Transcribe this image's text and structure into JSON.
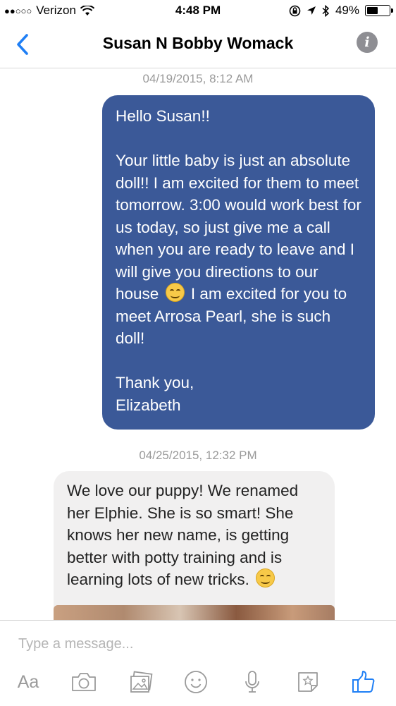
{
  "status_bar": {
    "signal_dots": "●●○○○",
    "carrier": "Verizon",
    "time": "4:48 PM",
    "battery_percent": "49%",
    "battery_level": 0.49
  },
  "nav": {
    "title": "Susan N Bobby Womack",
    "back_icon": "chevron-left-icon",
    "info_icon": "info-icon",
    "info_glyph": "i"
  },
  "conversation": {
    "messages": [
      {
        "timestamp": "04/19/2015, 8:12 AM",
        "direction": "outgoing",
        "greeting": "Hello Susan!!",
        "body_part1": "Your little baby is just an absolute doll!! I am excited for them to meet tomorrow. 3:00 would work best for us today, so just give me a call when you are ready to leave and I will give you directions to our house",
        "body_part2": "I am excited for you to meet Arrosa Pearl, she is such doll!",
        "sign_off_1": "Thank you,",
        "sign_off_2": "Elizabeth"
      },
      {
        "timestamp": "04/25/2015, 12:32 PM",
        "direction": "incoming",
        "body": "We love our puppy!  We renamed her Elphie.  She is so smart!  She knows her new name, is getting better with potty training and is learning lots of new tricks."
      }
    ]
  },
  "composer": {
    "placeholder": "Type a message...",
    "text_format_label": "Aa",
    "tools": [
      "text-format-icon",
      "camera-icon",
      "photo-gallery-icon",
      "emoji-icon",
      "microphone-icon",
      "sticker-icon",
      "like-thumb-icon"
    ]
  },
  "colors": {
    "outgoing_bubble": "#3b5998",
    "incoming_bubble": "#f1f0f0",
    "accent_blue": "#1f7ff5",
    "icon_gray": "#9a9a9a"
  }
}
